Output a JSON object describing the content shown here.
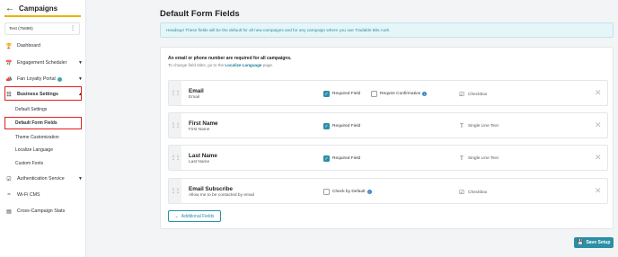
{
  "sidebar": {
    "title": "Campaigns",
    "account": "Test (75899)",
    "items": [
      {
        "label": "Dashboard",
        "icon": "trophy-icon"
      },
      {
        "label": "Engagement Scheduler",
        "icon": "calendar-icon"
      },
      {
        "label": "Fan Loyalty Portal",
        "icon": "megaphone-icon"
      },
      {
        "label": "Business Settings",
        "icon": "sliders-icon"
      },
      {
        "label": "Authentication Service",
        "icon": "shield-check-icon"
      },
      {
        "label": "Wi-Fi CMS",
        "icon": "wifi-icon"
      },
      {
        "label": "Cross-Campaign Stats",
        "icon": "bar-chart-icon"
      }
    ],
    "subitems": [
      {
        "label": "Default Settings"
      },
      {
        "label": "Default Form Fields"
      },
      {
        "label": "Theme Customization"
      },
      {
        "label": "Localize Language"
      },
      {
        "label": "Custom Fonts"
      }
    ]
  },
  "main": {
    "title": "Default Form Fields",
    "notice": "Headsup! These fields will be the default for all new campaigns and for any campaign where you use Tradable Bits Auth.",
    "required_text": "An email or phone number are required for all campaigns.",
    "required_sub_prefix": "To change field titles, go to the",
    "required_sub_link": "Localize Language",
    "required_sub_suffix": "page.",
    "fields": [
      {
        "title": "Email",
        "subtitle": "Email",
        "required_label": "Required Field",
        "required": true,
        "confirm_label": "Require Confirmation",
        "confirm": false,
        "type": "Checkbox"
      },
      {
        "title": "First Name",
        "subtitle": "First Name",
        "required_label": "Required Field",
        "required": true,
        "type": "Single Line Text"
      },
      {
        "title": "Last Name",
        "subtitle": "Last Name",
        "required_label": "Required Field",
        "required": true,
        "type": "Single Line Text"
      },
      {
        "title": "Email Subscribe",
        "subtitle": "Allow me to be contacted by email",
        "default_label": "Check by Default",
        "default": false,
        "type": "Checkbox"
      }
    ],
    "additional_fields_label": "Additional Fields",
    "save_label": "Save Setup"
  },
  "colors": {
    "accent": "#2b8fa6",
    "highlight": "#e02020",
    "brand_bar": "#f0b000"
  }
}
